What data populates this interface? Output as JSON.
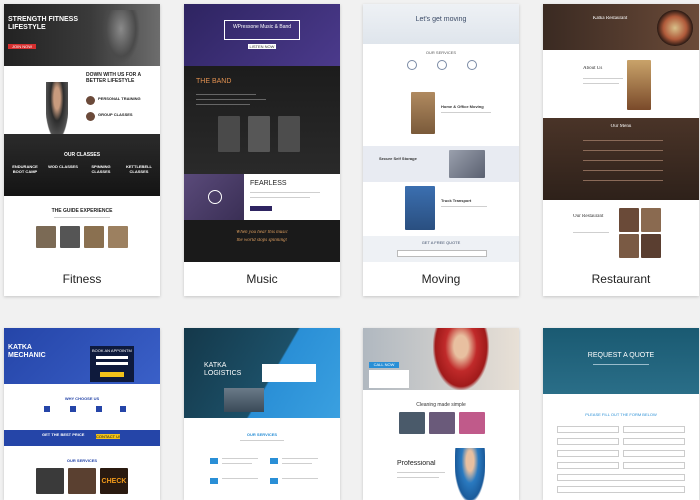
{
  "templates": [
    {
      "label": "Fitness"
    },
    {
      "label": "Music"
    },
    {
      "label": "Moving"
    },
    {
      "label": "Restaurant"
    }
  ],
  "fitness": {
    "hero_title": "STRENGTH FITNESS LIFESTYLE",
    "hero_btn": "JOIN NOW",
    "section_title": "DOWN WITH US FOR A BETTER LIFESTYLE",
    "point1": "PERSONAL TRAINING",
    "point2": "GROUP CLASSES",
    "classes_title": "OUR CLASSES",
    "class1": "ENDURANCE BOOT CAMP",
    "class2": "WOD CLASSES",
    "class3": "SPINNING CLASSES",
    "class4": "KETTLEBELL CLASSES",
    "experience_title": "THE GUIDE EXPERIENCE"
  },
  "music": {
    "hero_title": "WPressone Music & Band",
    "hero_btn": "LISTEN NOW",
    "band_title": "THE BAND",
    "fearless": "FEARLESS",
    "quote_line1": "When you hear this music",
    "quote_line2": "the world stops spinning!"
  },
  "moving": {
    "hero_title": "Let's get moving",
    "services_title": "OUR SERVICES",
    "item1": "Home & Office Moving",
    "item2": "Secure Self Storage",
    "item3": "Truck Transport",
    "cta": "GET A FREE QUOTE"
  },
  "restaurant": {
    "brand": "Katka Restaurant",
    "about_title": "About Us",
    "menu_title": "Our Menu",
    "team_title": "Our Restaurant"
  },
  "mechanic": {
    "brand": "KATKA MECHANIC",
    "form_title": "BOOK AN APPOINTMENT",
    "why_title": "WHY CHOOSE US",
    "cta_text": "GET THE BEST PRICE",
    "cta_btn": "CONTACT US",
    "services_title": "OUR SERVICES",
    "promo": "CHECK"
  },
  "logistics": {
    "brand": "KATKA LOGISTICS",
    "services_title": "OUR SERVICES"
  },
  "cleaning": {
    "badge": "CALL NOW",
    "tagline": "Cleaning made simple",
    "professional": "Professional"
  },
  "quote": {
    "hero_title": "REQUEST A QUOTE",
    "form_title": "PLEASE FILL OUT THE FORM BELOW"
  }
}
